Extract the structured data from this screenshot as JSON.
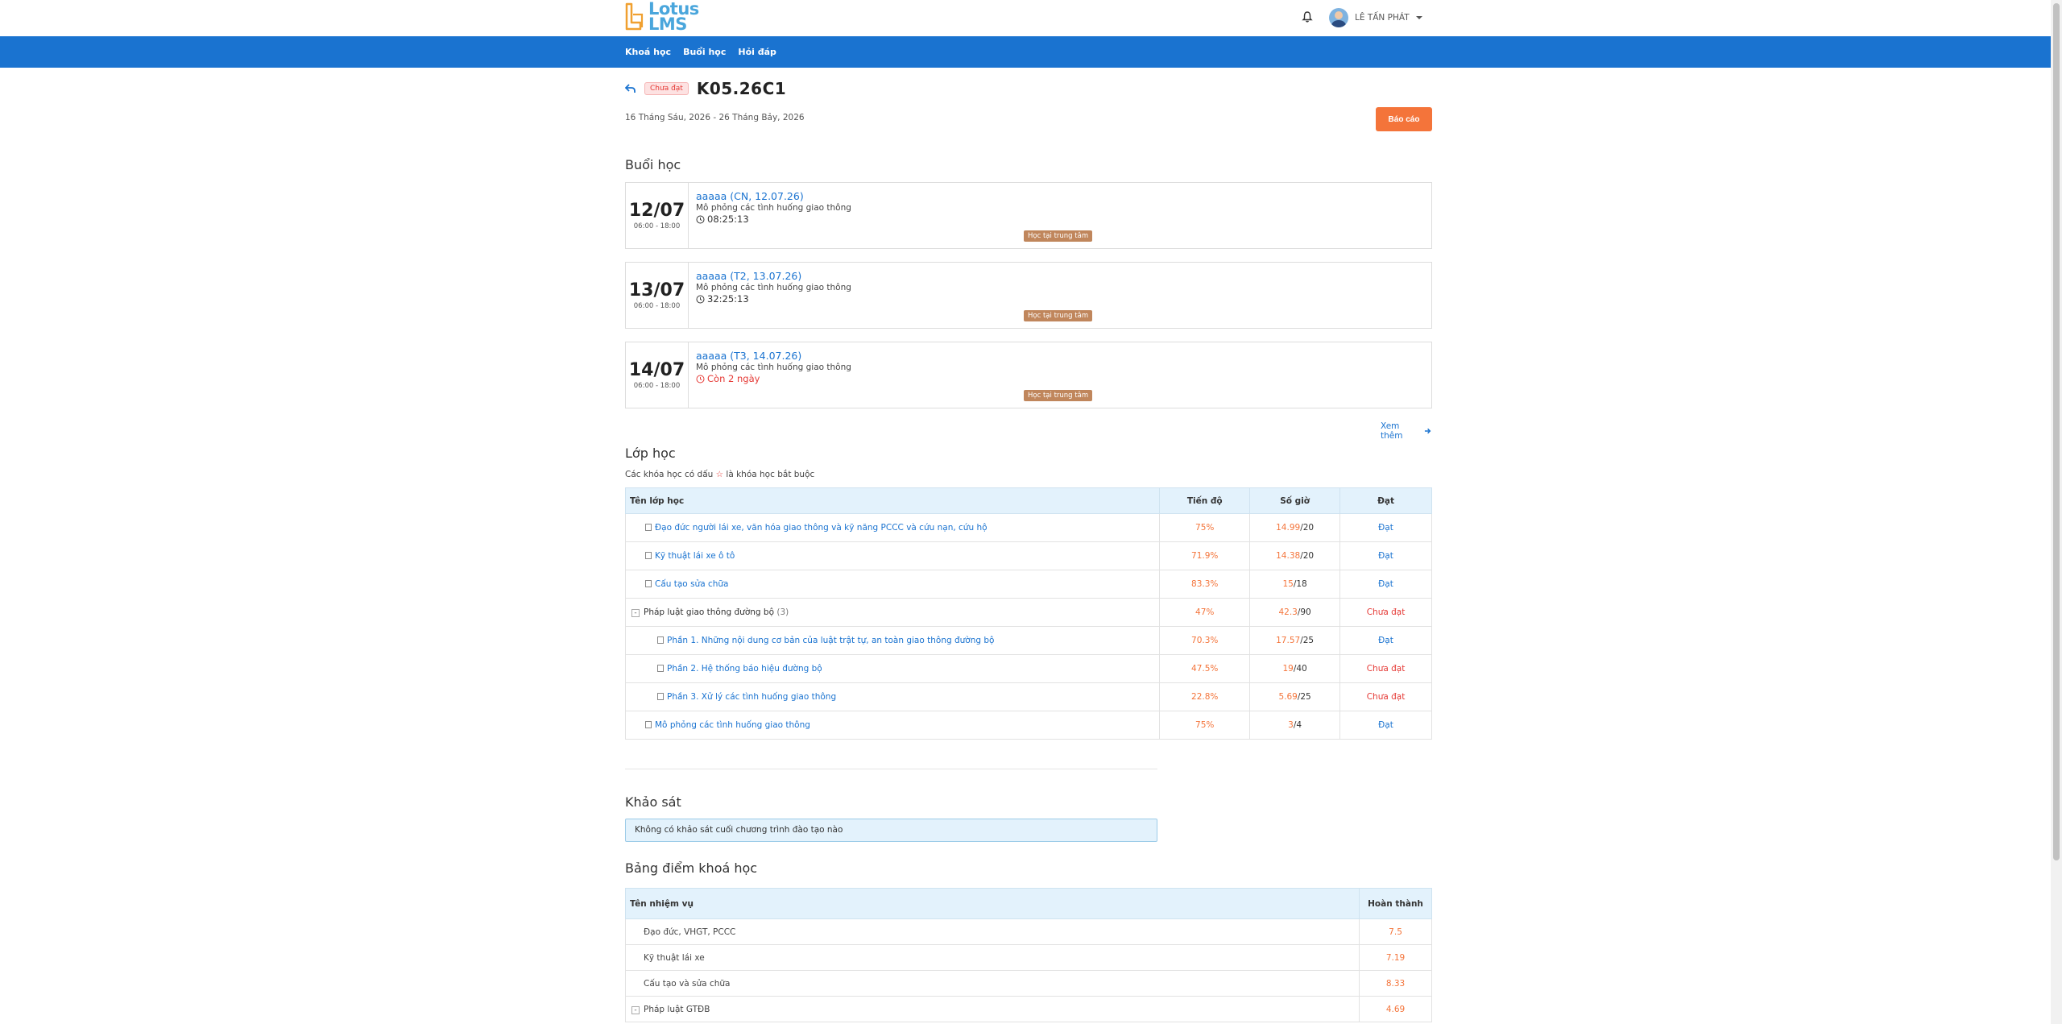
{
  "header": {
    "logo_top": "Lotus",
    "logo_bottom": "LMS",
    "user_name": "LÊ TẤN PHÁT"
  },
  "nav": [
    "Khoá học",
    "Buổi học",
    "Hỏi đáp"
  ],
  "page": {
    "status_badge": "Chưa đạt",
    "title": "K05.26C1",
    "date_range": "16 Tháng Sáu, 2026 - 26 Tháng Bảy, 2026",
    "report_button": "Báo cáo"
  },
  "sessions_section": {
    "heading": "Buổi học",
    "see_more": "Xem thêm",
    "items": [
      {
        "day": "12/07",
        "time": "06:00 - 18:00",
        "title": "aaaaa (CN, 12.07.26)",
        "subtitle": "Mô phỏng các tình huống giao thông",
        "countdown": "08:25:13",
        "tag": "Học tại trung tâm"
      },
      {
        "day": "13/07",
        "time": "06:00 - 18:00",
        "title": "aaaaa (T2, 13.07.26)",
        "subtitle": "Mô phỏng các tình huống giao thông",
        "countdown": "32:25:13",
        "tag": "Học tại trung tâm"
      },
      {
        "day": "14/07",
        "time": "06:00 - 18:00",
        "title": "aaaaa (T3, 14.07.26)",
        "subtitle": "Mô phỏng các tình huống giao thông",
        "countdown": "Còn 2 ngày",
        "tag": "Học tại trung tâm"
      }
    ]
  },
  "classes_section": {
    "heading": "Lớp học",
    "note_before": "Các khóa học có dấu",
    "note_star": "☆",
    "note_after": "là khóa học bắt buộc",
    "columns": [
      "Tên lớp học",
      "Tiến độ",
      "Số giờ",
      "Đạt"
    ],
    "rows": [
      {
        "name": "Đạo đức người lái xe, văn hóa giao thông và kỹ năng PCCC và cứu nạn, cứu hộ",
        "progress": "75%",
        "hours": "14.99",
        "hours_total": "/20",
        "status": "Đạt"
      },
      {
        "name": "Kỹ thuật lái xe ô tô",
        "progress": "71.9%",
        "hours": "14.38",
        "hours_total": "/20",
        "status": "Đạt"
      },
      {
        "name": "Cấu tạo sửa chữa",
        "progress": "83.3%",
        "hours": "15",
        "hours_total": "/18",
        "status": "Đạt"
      },
      {
        "name": "Pháp luật giao thông đường bộ",
        "count": "(3)",
        "toggle": "-",
        "progress": "47%",
        "hours": "42.3",
        "hours_total": "/90",
        "status": "Chưa đạt"
      },
      {
        "name": "Phần 1. Những nội dung cơ bản của luật trật tự, an toàn giao thông đường bộ",
        "progress": "70.3%",
        "hours": "17.57",
        "hours_total": "/25",
        "status": "Đạt"
      },
      {
        "name": "Phần 2. Hệ thống báo hiệu đường bộ",
        "progress": "47.5%",
        "hours": "19",
        "hours_total": "/40",
        "status": "Chưa đạt"
      },
      {
        "name": "Phần 3. Xử lý các tình huống giao thông",
        "progress": "22.8%",
        "hours": "5.69",
        "hours_total": "/25",
        "status": "Chưa đạt"
      },
      {
        "name": "Mô phỏng các tình huống giao thông",
        "progress": "75%",
        "hours": "3",
        "hours_total": "/4",
        "status": "Đạt"
      }
    ]
  },
  "survey_section": {
    "heading": "Khảo sát",
    "empty_message": "Không có khảo sát cuối chương trình đào tạo nào"
  },
  "scores_section": {
    "heading": "Bảng điểm khoá học",
    "columns": [
      "Tên nhiệm vụ",
      "Hoàn thành"
    ],
    "rows": [
      {
        "name": "Đạo đức, VHGT, PCCC",
        "score": "7.5"
      },
      {
        "name": "Kỹ thuật lái xe",
        "score": "7.19"
      },
      {
        "name": "Cấu tạo và sửa chữa",
        "score": "8.33"
      },
      {
        "name": "Pháp luật GTĐB",
        "score": "4.69",
        "toggle": "-"
      }
    ]
  },
  "colors": {
    "nav_blue": "#1a73d0",
    "accent_orange": "#f4743a",
    "fail_red": "#e53935",
    "tag_brown": "#c0865c",
    "table_header": "#e3f2fc"
  }
}
